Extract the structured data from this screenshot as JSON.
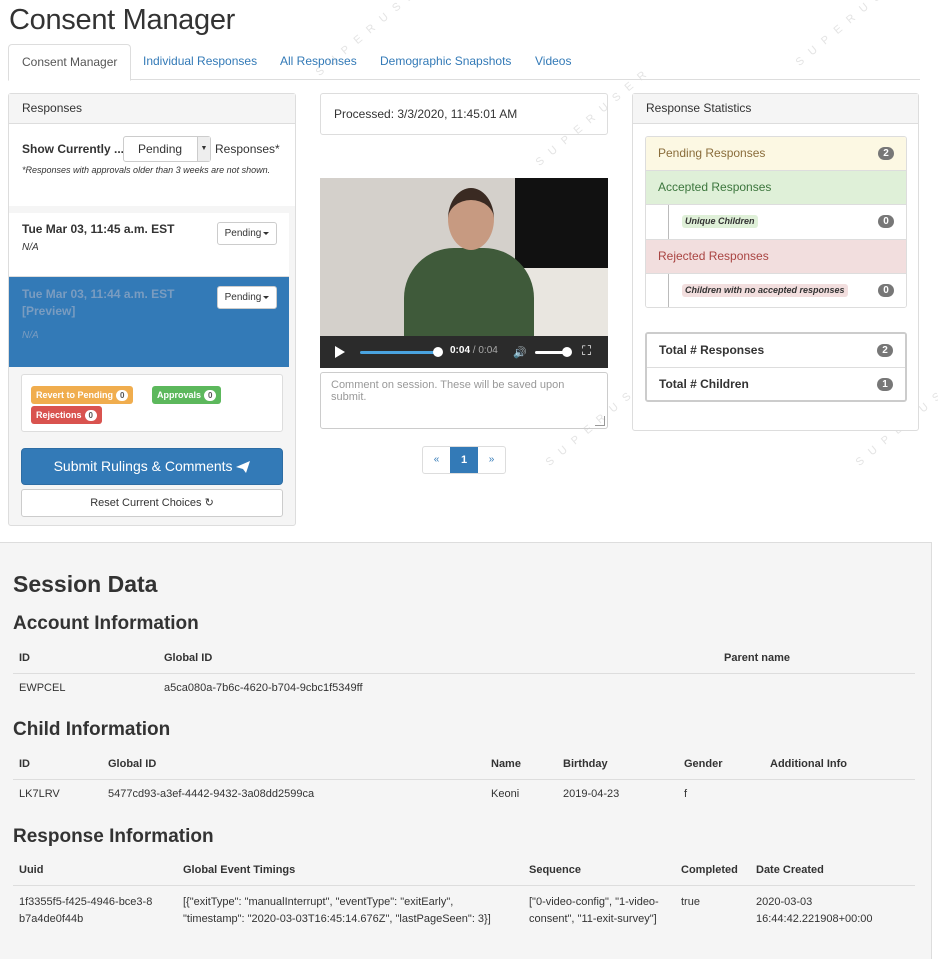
{
  "page": {
    "title": "Consent Manager"
  },
  "tabs": [
    {
      "label": "Consent Manager"
    },
    {
      "label": "Individual Responses"
    },
    {
      "label": "All Responses"
    },
    {
      "label": "Demographic Snapshots"
    },
    {
      "label": "Videos"
    }
  ],
  "responses_panel": {
    "heading": "Responses",
    "show_label": "Show Currently ...",
    "filter_value": "Pending",
    "filter_suffix": "Responses*",
    "note": "*Responses with approvals older than 3 weeks are not shown.",
    "items": [
      {
        "date": "Tue Mar 03, 11:45 a.m. EST",
        "sub": "N/A",
        "status": "Pending"
      },
      {
        "date": "Tue Mar 03, 11:44 a.m. EST [Preview]",
        "sub": "N/A",
        "status": "Pending"
      }
    ],
    "labels": {
      "revert": "Revert to Pending",
      "revert_count": "0",
      "approvals": "Approvals",
      "approvals_count": "0",
      "rejections": "Rejections",
      "rejections_count": "0"
    },
    "submit_label": "Submit Rulings & Comments",
    "reset_label": "Reset Current Choices"
  },
  "player": {
    "processed": "Processed: 3/3/2020, 11:45:01 AM",
    "time_current": "0:04",
    "time_total": " / 0:04",
    "progress": 1.0,
    "volume": 1.0,
    "comment_placeholder": "Comment on session. These will be saved upon submit."
  },
  "pagination": {
    "prev": "«",
    "current": "1",
    "next": "»"
  },
  "stats": {
    "heading": "Response Statistics",
    "pending_label": "Pending Responses",
    "pending_count": "2",
    "accepted_label": "Accepted Responses",
    "unique_children_label": "Unique Children",
    "unique_children_count": "0",
    "rejected_label": "Rejected Responses",
    "no_accepted_label": "Children with no accepted responses",
    "no_accepted_count": "0",
    "total_responses_label": "Total # Responses",
    "total_responses_count": "2",
    "total_children_label": "Total # Children",
    "total_children_count": "1"
  },
  "session": {
    "title": "Session Data",
    "account": {
      "title": "Account Information",
      "headers": [
        "ID",
        "Global ID",
        "Parent name"
      ],
      "row": [
        "EWPCEL",
        "a5ca080a-7b6c-4620-b704-9cbc1f5349ff",
        ""
      ]
    },
    "child": {
      "title": "Child Information",
      "headers": [
        "ID",
        "Global ID",
        "Name",
        "Birthday",
        "Gender",
        "Additional Info"
      ],
      "row": [
        "LK7LRV",
        "5477cd93-a3ef-4442-9432-3a08dd2599ca",
        "Keoni",
        "2019-04-23",
        "f",
        ""
      ]
    },
    "response": {
      "title": "Response Information",
      "headers": [
        "Uuid",
        "Global Event Timings",
        "Sequence",
        "Completed",
        "Date Created"
      ],
      "row": [
        "1f3355f5-f425-4946-bce3-8b7a4de0f44b",
        "[{\"exitType\": \"manualInterrupt\", \"eventType\": \"exitEarly\", \"timestamp\": \"2020-03-03T16:45:14.676Z\", \"lastPageSeen\": 3}]",
        "[\"0-video-config\", \"1-video-consent\", \"11-exit-survey\"]",
        "true",
        "2020-03-03 16:44:42.221908+00:00"
      ]
    }
  },
  "watermark": "SUPERUSER"
}
